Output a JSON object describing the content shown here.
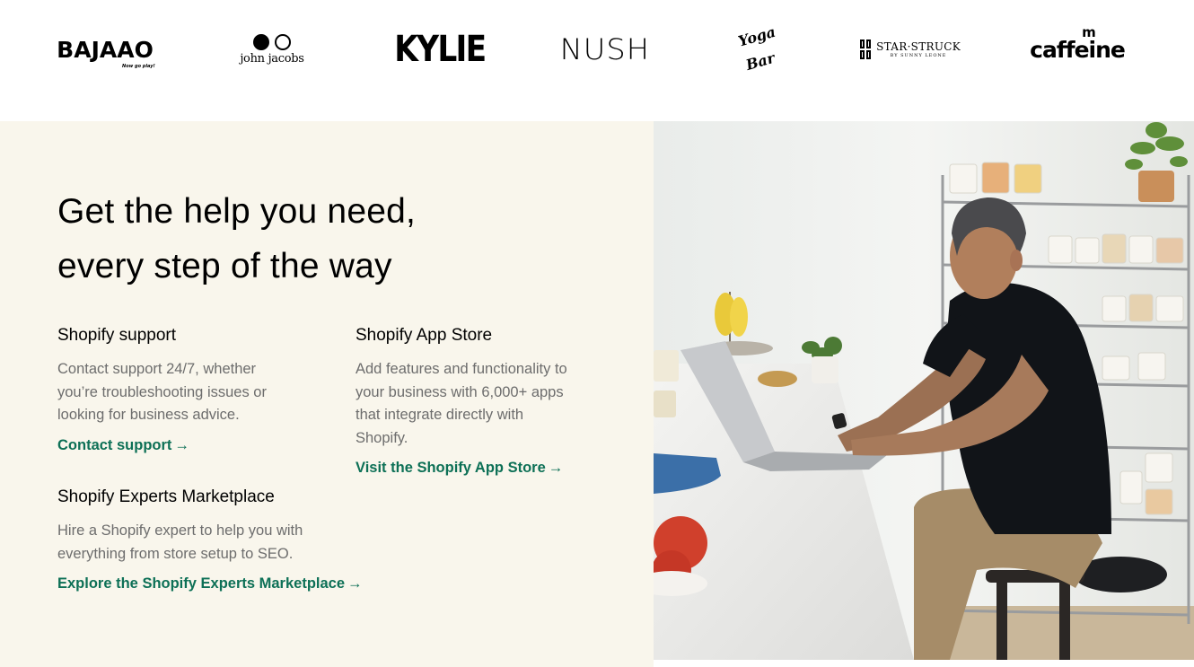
{
  "logos": {
    "bajaao": "BAJAAO",
    "bajaao_tag": "Now go play!",
    "john_jacobs": "john jacobs",
    "kylie": "KYLIE",
    "nush": "NUSH",
    "yogabar_1": "Yoga",
    "yogabar_2": "Bar",
    "starstruck": "STAR·STRUCK",
    "starstruck_sub": "BY SUNNY LEONE",
    "mcaffeine_m": "m",
    "mcaffeine": "caffeine"
  },
  "help": {
    "heading_line1": "Get the help you need,",
    "heading_line2": "every step of the way",
    "support": {
      "title": "Shopify support",
      "description": "Contact support 24/7, whether you’re troubleshooting issues or looking for business advice.",
      "link_label": "Contact support",
      "arrow": "→"
    },
    "app_store": {
      "title": "Shopify App Store",
      "description": "Add features and functionality to your business with 6,000+ apps that integrate directly with Shopify.",
      "link_label": "Visit the Shopify App Store",
      "arrow": "→"
    },
    "experts": {
      "title": "Shopify Experts Marketplace",
      "description": "Hire a Shopify expert to help you with everything from store setup to SEO.",
      "link_label": "Explore the Shopify Experts Marketplace",
      "arrow": "→"
    }
  },
  "colors": {
    "section_bg": "#f9f6ec",
    "link_green": "#0d7056",
    "body_text_gray": "#6d6d6d"
  }
}
